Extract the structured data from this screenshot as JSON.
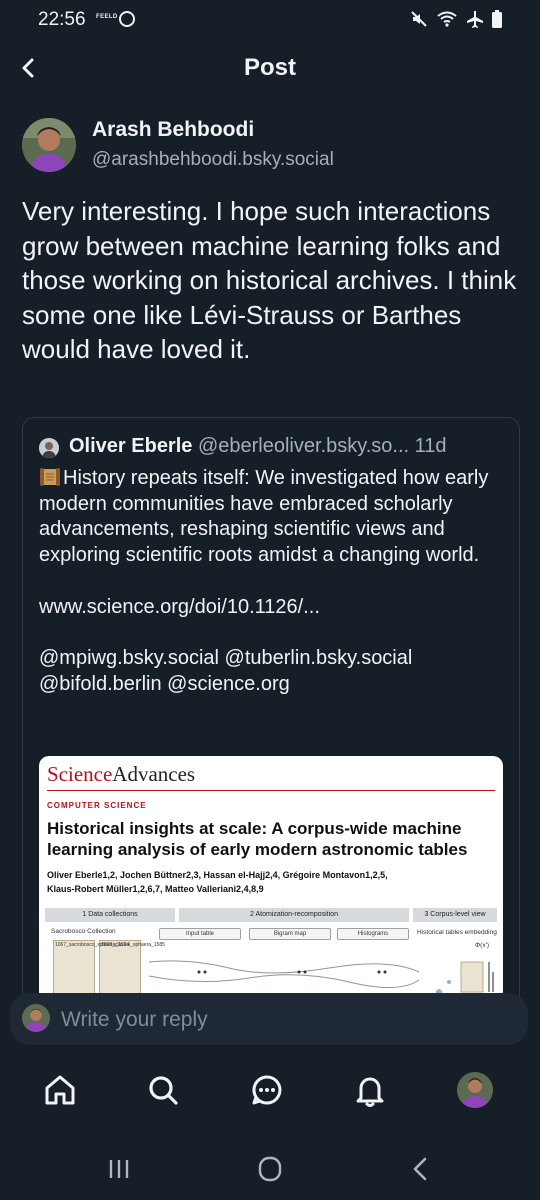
{
  "status_bar": {
    "time": "22:56",
    "app_text": "FEELD"
  },
  "header": {
    "title": "Post"
  },
  "post": {
    "author_name": "Arash Behboodi",
    "author_handle": "@arashbehboodi.bsky.social",
    "text": "Very interesting. I hope such interactions grow between machine learning folks and those working on historical archives. I think some one like Lévi-Strauss or Barthes would have loved it."
  },
  "quote": {
    "author_name": "Oliver Eberle",
    "author_handle": "@eberleoliver.bsky.so...",
    "time": "11d",
    "text": "History repeats itself: We investigated how early modern communities have embraced scholarly advancements, reshaping scientific views and exploring scientific roots amidst a changing world.\n\nwww.science.org/doi/10.1126/...\n\n@mpiwg.bsky.social @tuberlin.bsky.social @bifold.berlin @science.org",
    "emoji_icon": "scroll-icon",
    "image": {
      "journal_part1": "Science",
      "journal_part2": "Advances",
      "section": "COMPUTER SCIENCE",
      "title": "Historical insights at scale: A corpus-wide machine\nlearning analysis of early modern astronomic tables",
      "authors": "Oliver Eberle1,2, Jochen Büttner2,3, Hassan el-Hajj2,4, Grégoire Montavon1,2,5,\nKlaus-Robert Müller1,2,6,7, Matteo Valleriani2,4,8,9",
      "steps": [
        "1 Data collections",
        "2 Atomization-recomposition",
        "3 Corpus-level view"
      ],
      "labels": {
        "collection": "Sacrobosco Collection",
        "book1": "1067_sacrobosco_sphaera_1524",
        "book2": "1808_clavius_sphaera_1585",
        "input_table": "Input table",
        "bigram_map": "Bigram map",
        "histograms": "Histograms",
        "embedding": "Historical tables embedding",
        "phi": "Φ(x')"
      }
    }
  },
  "reply": {
    "placeholder": "Write your reply"
  },
  "nav": [
    "home-icon",
    "search-icon",
    "chat-icon",
    "bell-icon",
    "profile-avatar"
  ],
  "colors": {
    "background": "#161e27",
    "secondary_text": "#a2b0bd",
    "border": "#2e3a46",
    "science_red": "#b3121d"
  }
}
